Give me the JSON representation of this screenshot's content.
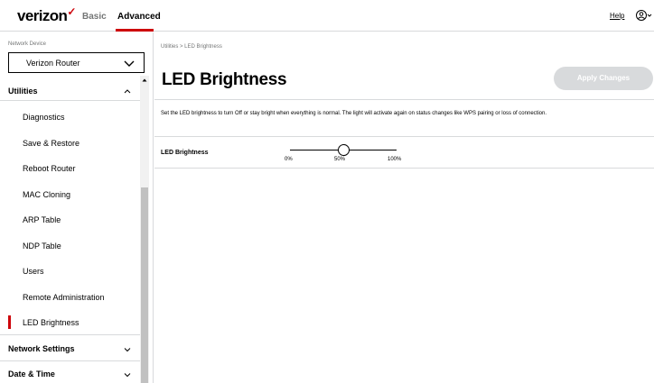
{
  "header": {
    "logo": "verizon",
    "logo_mark": "✓",
    "tabs": [
      {
        "label": "Basic",
        "active": false
      },
      {
        "label": "Advanced",
        "active": true
      }
    ],
    "help_label": "Help",
    "user_icon": "user-circle-icon"
  },
  "sidebar": {
    "device_label": "Network Device",
    "device_value": "Verizon Router",
    "sections": [
      {
        "label": "Utilities",
        "expanded": true,
        "items": [
          {
            "label": "Diagnostics"
          },
          {
            "label": "Save & Restore"
          },
          {
            "label": "Reboot Router"
          },
          {
            "label": "MAC Cloning"
          },
          {
            "label": "ARP Table"
          },
          {
            "label": "NDP Table"
          },
          {
            "label": "Users"
          },
          {
            "label": "Remote Administration"
          },
          {
            "label": "LED Brightness",
            "active": true
          }
        ]
      },
      {
        "label": "Network Settings",
        "expanded": false
      },
      {
        "label": "Date & Time",
        "expanded": false
      }
    ]
  },
  "main": {
    "breadcrumb": "Utilities  >  LED Brightness",
    "title": "LED Brightness",
    "apply_label": "Apply Changes",
    "description": "Set the LED brightness to turn Off or stay bright when everything is normal. The light will activate again on status changes like WPS pairing or loss of connection.",
    "setting": {
      "label": "LED Brightness",
      "value_percent": 50,
      "ticks": [
        "0%",
        "50%",
        "100%"
      ]
    }
  },
  "colors": {
    "brand_red": "#cd040b",
    "divider": "#d8dadc",
    "muted": "#747676",
    "disabled_button": "#d8dadc"
  }
}
